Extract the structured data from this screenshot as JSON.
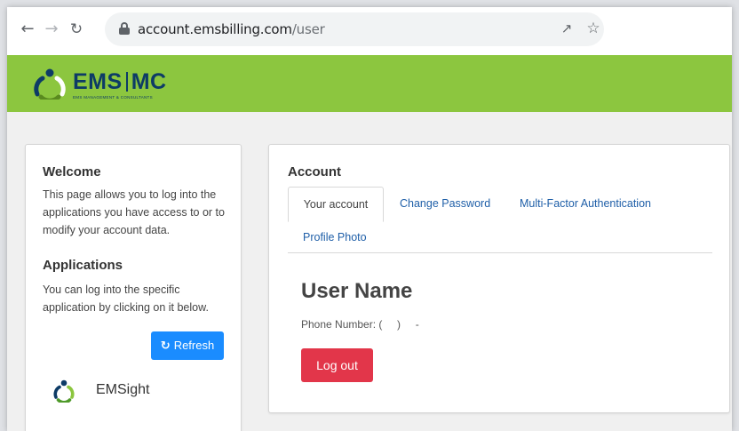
{
  "browser": {
    "url_host": "account.emsbilling.com",
    "url_path": "/user",
    "icons": [
      "back-arrow-icon",
      "forward-arrow-icon",
      "reload-icon",
      "lock-icon",
      "share-icon",
      "star-icon"
    ]
  },
  "header": {
    "logo_text_left": "EMS",
    "logo_text_right": "MC",
    "logo_subtitle": "EMS MANAGEMENT & CONSULTANTS",
    "background_color": "#8cc63f",
    "logo_color": "#0d3b66"
  },
  "sidebar": {
    "welcome_title": "Welcome",
    "welcome_text": "This page allows you to log into the applications you have access to or to modify your account data.",
    "applications_title": "Applications",
    "applications_text": "You can log into the specific application by clicking on it below.",
    "refresh_label": "Refresh",
    "refresh_color": "#1a8cff",
    "apps": [
      {
        "label": "EMSight",
        "icon": "emsight-logo-icon"
      }
    ]
  },
  "account": {
    "title": "Account",
    "tabs": [
      {
        "label": "Your account",
        "active": true
      },
      {
        "label": "Change Password",
        "active": false
      },
      {
        "label": "Multi-Factor Authentication",
        "active": false
      },
      {
        "label": "Profile Photo",
        "active": false
      }
    ],
    "user_name": "User Name",
    "phone_label": "Phone Number:",
    "phone_value": "(     )     -",
    "logout_label": "Log out",
    "logout_color": "#e2364a"
  }
}
